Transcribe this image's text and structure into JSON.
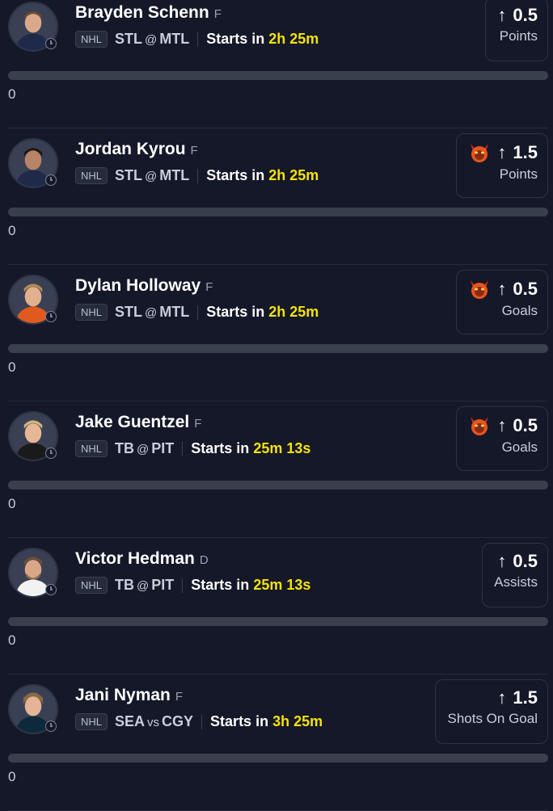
{
  "players": [
    {
      "name": "Brayden Schenn",
      "position": "F",
      "league": "NHL",
      "away": "STL",
      "sep": "@",
      "home": "MTL",
      "starts_label": "Starts in",
      "time": "2h 25m",
      "line": "0.5",
      "stat": "Points",
      "demon": false,
      "count": "0",
      "direction": "↑"
    },
    {
      "name": "Jordan Kyrou",
      "position": "F",
      "league": "NHL",
      "away": "STL",
      "sep": "@",
      "home": "MTL",
      "starts_label": "Starts in",
      "time": "2h 25m",
      "line": "1.5",
      "stat": "Points",
      "demon": true,
      "count": "0",
      "direction": "↑"
    },
    {
      "name": "Dylan Holloway",
      "position": "F",
      "league": "NHL",
      "away": "STL",
      "sep": "@",
      "home": "MTL",
      "starts_label": "Starts in",
      "time": "2h 25m",
      "line": "0.5",
      "stat": "Goals",
      "demon": true,
      "count": "0",
      "direction": "↑"
    },
    {
      "name": "Jake Guentzel",
      "position": "F",
      "league": "NHL",
      "away": "TB",
      "sep": "@",
      "home": "PIT",
      "starts_label": "Starts in",
      "time": "25m 13s",
      "line": "0.5",
      "stat": "Goals",
      "demon": true,
      "count": "0",
      "direction": "↑"
    },
    {
      "name": "Victor Hedman",
      "position": "D",
      "league": "NHL",
      "away": "TB",
      "sep": "@",
      "home": "PIT",
      "starts_label": "Starts in",
      "time": "25m 13s",
      "line": "0.5",
      "stat": "Assists",
      "demon": false,
      "count": "0",
      "direction": "↑"
    },
    {
      "name": "Jani Nyman",
      "position": "F",
      "league": "NHL",
      "away": "SEA",
      "sep": "vs",
      "home": "CGY",
      "starts_label": "Starts in",
      "time": "3h 25m",
      "line": "1.5",
      "stat": "Shots On Goal",
      "demon": false,
      "count": "0",
      "direction": "↑"
    }
  ],
  "icons": {
    "avatar": "player-headshot",
    "clock": "clock-icon",
    "demon": "demon-icon",
    "arrow": "arrow-up-icon"
  },
  "colors": {
    "background": "#141828",
    "accent_time": "#f5e20b",
    "progress_track": "#3a3f4e"
  }
}
